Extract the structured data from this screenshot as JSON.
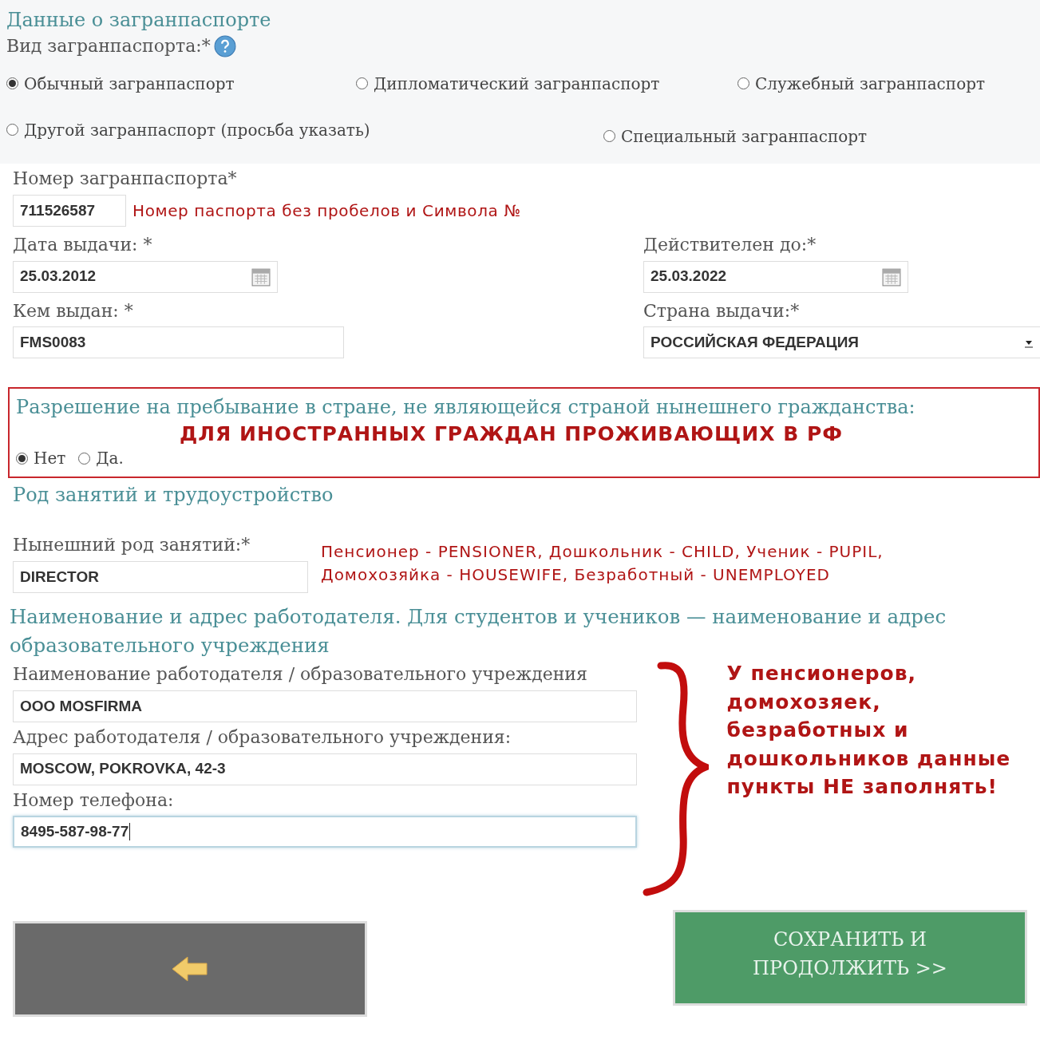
{
  "section_title": "Данные о загранпаспорте",
  "passport_type": {
    "label": "Вид загранпаспорта:*",
    "options": [
      {
        "label": "Обычный загранпаспорт",
        "selected": true
      },
      {
        "label": "Дипломатический загранпаспорт",
        "selected": false
      },
      {
        "label": "Служебный загранпаспорт",
        "selected": false
      },
      {
        "label": "Другой загранпаспорт (просьба указать)",
        "selected": false
      },
      {
        "label": "Специальный загранпаспорт",
        "selected": false
      }
    ]
  },
  "passport_number": {
    "label": "Номер загранпаспорта*",
    "value": "711526587",
    "hint": "Номер паспорта без пробелов и Символа №"
  },
  "issue_date": {
    "label": "Дата выдачи: *",
    "value": "25.03.2012"
  },
  "valid_until": {
    "label": "Действителен до:*",
    "value": "25.03.2022"
  },
  "issued_by": {
    "label": "Кем выдан: *",
    "value": "FMS0083"
  },
  "country": {
    "label": "Страна выдачи:*",
    "value": "РОССИЙСКАЯ ФЕДЕРАЦИЯ"
  },
  "residence_permit": {
    "title": "Разрешение на пребывание в стране, не являющейся страной нынешнего гражданства:",
    "note": "ДЛЯ ИНОСТРАННЫХ ГРАЖДАН ПРОЖИВАЮЩИХ В РФ",
    "options": [
      {
        "label": "Нет",
        "selected": true
      },
      {
        "label": "Да.",
        "selected": false
      }
    ]
  },
  "occupation_title": "Род занятий и трудоустройство",
  "occupation": {
    "label": "Нынешний род занятий:*",
    "value": "DIRECTOR",
    "hint_lines": [
      "Пенсионер - PENSIONER, Дошкольник - CHILD, Ученик - PUPIL,",
      "Домохозяйка - HOUSEWIFE, Безработный - UNEMPLOYED"
    ]
  },
  "employer_title": "Наименование и адрес работодателя. Для студентов и учеников — наименование и адрес образовательного учреждения",
  "employer_fields": [
    {
      "label": "Наименование работодателя / образовательного учреждения",
      "value": "OOO MOSFIRMA",
      "focused": false
    },
    {
      "label": "Адрес работодателя / образовательного учреждения:",
      "value": "MOSCOW, POKROVKA, 42-3",
      "focused": false
    },
    {
      "label": "Номер телефона:",
      "value": "8495-587-98-77",
      "focused": true
    }
  ],
  "employer_note": "У пенсионеров, домохозяек, безработных и дошкольников данные пункты НЕ заполнять!",
  "save_button": "СОХРАНИТЬ И ПРОДОЛЖИТЬ >>"
}
